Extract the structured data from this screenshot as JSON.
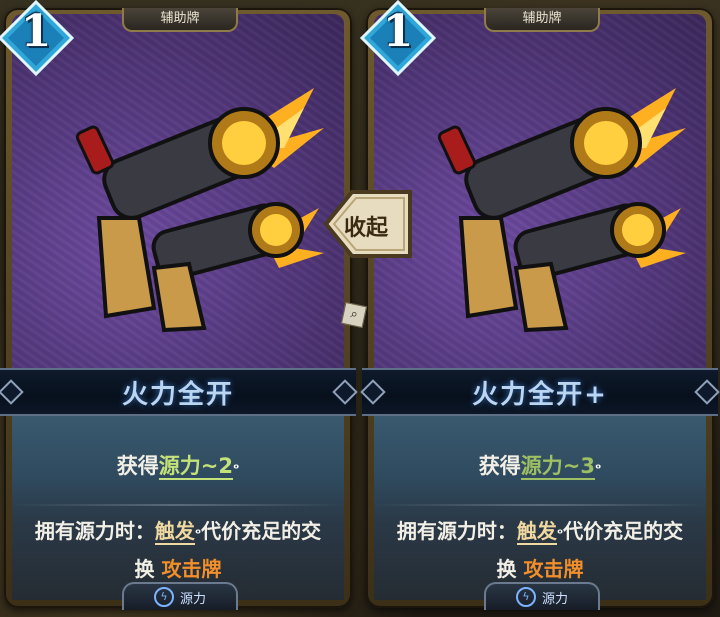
{
  "cards": [
    {
      "cost": "1",
      "type": "辅助牌",
      "name": "火力全开",
      "gain_prefix": "获得",
      "gain_keyword": "源力~2",
      "effect_prefix": "拥有源力时：",
      "effect_keyword": "触发",
      "effect_mid": "代价充足的交换",
      "effect_target": "攻击牌",
      "source_tag": "源力"
    },
    {
      "cost": "1",
      "type": "辅助牌",
      "name": "火力全开+",
      "gain_prefix": "获得",
      "gain_keyword": "源力~3",
      "effect_prefix": "拥有源力时：",
      "effect_keyword": "触发",
      "effect_mid": "代价充足的交换",
      "effect_target": "攻击牌",
      "source_tag": "源力"
    }
  ],
  "collapse_button": {
    "label": "收起"
  },
  "icons": {
    "source": "lightning-icon",
    "zoom": "zoom-icon",
    "keyword_hint": "question-icon"
  },
  "colors": {
    "card_bg": "#55397f",
    "title_text": "#bcd6f2",
    "keyword_green": "#c5e27a",
    "keyword_orange": "#f28f2a"
  }
}
